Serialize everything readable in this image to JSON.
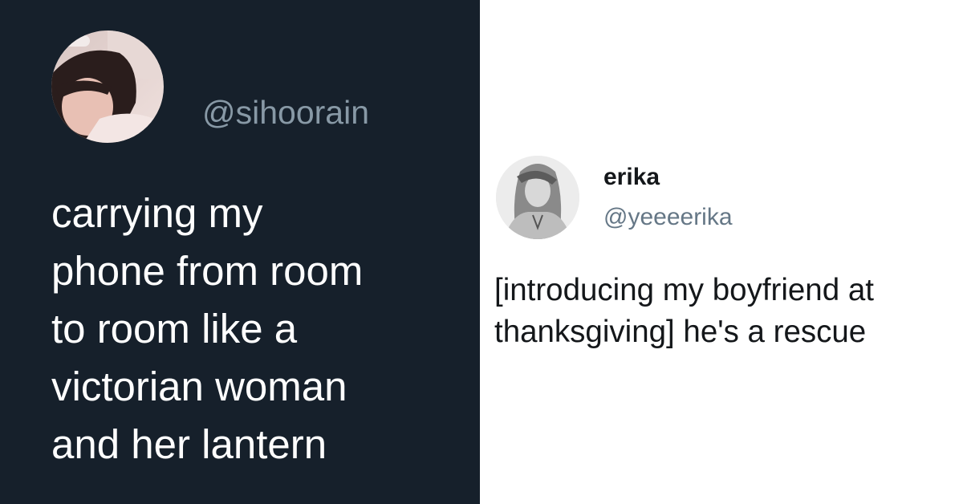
{
  "left_tweet": {
    "handle": "@sihoorain",
    "lines": [
      "carrying my",
      "phone from room",
      "to room like a",
      "victorian woman",
      "and her lantern"
    ]
  },
  "right_tweet": {
    "name": "erika",
    "handle": "@yeeeerika",
    "lines": [
      "[introducing my boyfriend at",
      "thanksgiving] he's a rescue"
    ]
  },
  "colors": {
    "left_background": "#16202b",
    "left_text": "#ffffff",
    "left_handle": "#8899a6",
    "right_background": "#ffffff",
    "right_text": "#14171a",
    "right_handle": "#657786"
  }
}
